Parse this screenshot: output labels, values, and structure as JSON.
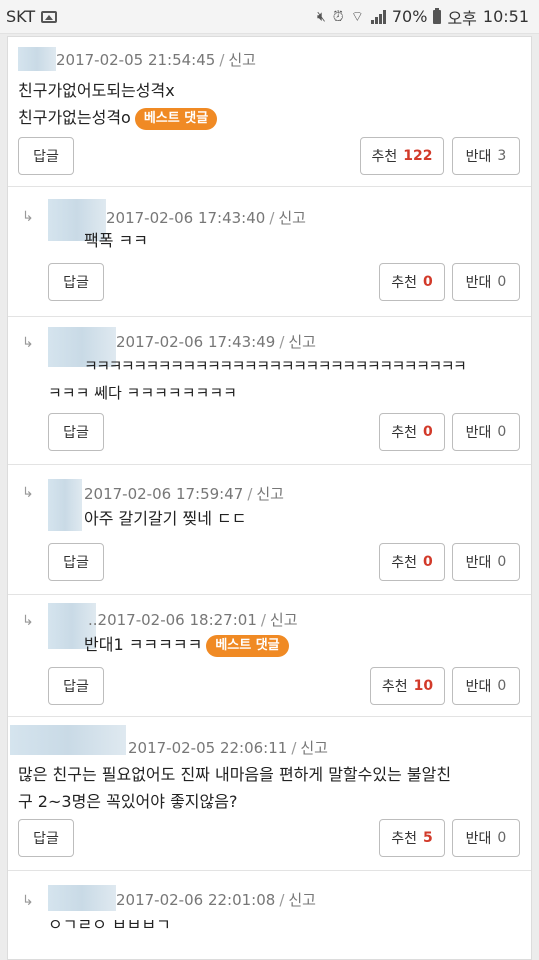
{
  "status_bar": {
    "carrier": "SKT",
    "battery": "70%",
    "ampm": "오후",
    "time": "10:51"
  },
  "labels": {
    "report": "신고",
    "reply": "답글",
    "recommend": "추천",
    "oppose": "반대",
    "best": "베스트 댓글"
  },
  "comments": [
    {
      "timestamp": "2017-02-05 21:54:45",
      "lines": [
        "친구가없어도되는성격x",
        "친구가없는성격o"
      ],
      "recommend": "122",
      "oppose": "3",
      "best": true
    },
    {
      "timestamp": "2017-02-06 17:43:40",
      "lines": [
        "팩폭 ㅋㅋ"
      ],
      "recommend": "0",
      "oppose": "0"
    },
    {
      "timestamp": "2017-02-06 17:43:49",
      "lines": [
        "ㅋㅋㅋㅋㅋㅋㅋㅋㅋㅋㅋㅋㅋㅋㅋㅋㅋㅋㅋㅋㅋㅋㅋㅋㅋㅋㅋㅋㅋㅋㅋ",
        "ㅋㅋㅋ 쎄다 ㅋㅋㅋㅋㅋㅋㅋㅋ"
      ],
      "recommend": "0",
      "oppose": "0"
    },
    {
      "timestamp": "2017-02-06 17:59:47",
      "lines": [
        "아주 갈기갈기 찢네 ㄷㄷ"
      ],
      "recommend": "0",
      "oppose": "0"
    },
    {
      "timestamp": "2017-02-06 18:27:01",
      "lines": [
        "반대1 ㅋㅋㅋㅋㅋ"
      ],
      "recommend": "10",
      "oppose": "0",
      "best": true
    },
    {
      "timestamp": "2017-02-05 22:06:11",
      "lines": [
        "많은 친구는 필요없어도 진짜 내마음을 편하게 말할수있는 불알친",
        "구 2~3명은 꼭있어야 좋지않음?"
      ],
      "recommend": "5",
      "oppose": "0"
    },
    {
      "timestamp": "2017-02-06 22:01:08",
      "lines": [
        "ㅇㄱㄹㅇ ㅂㅂㅂㄱ"
      ]
    }
  ]
}
